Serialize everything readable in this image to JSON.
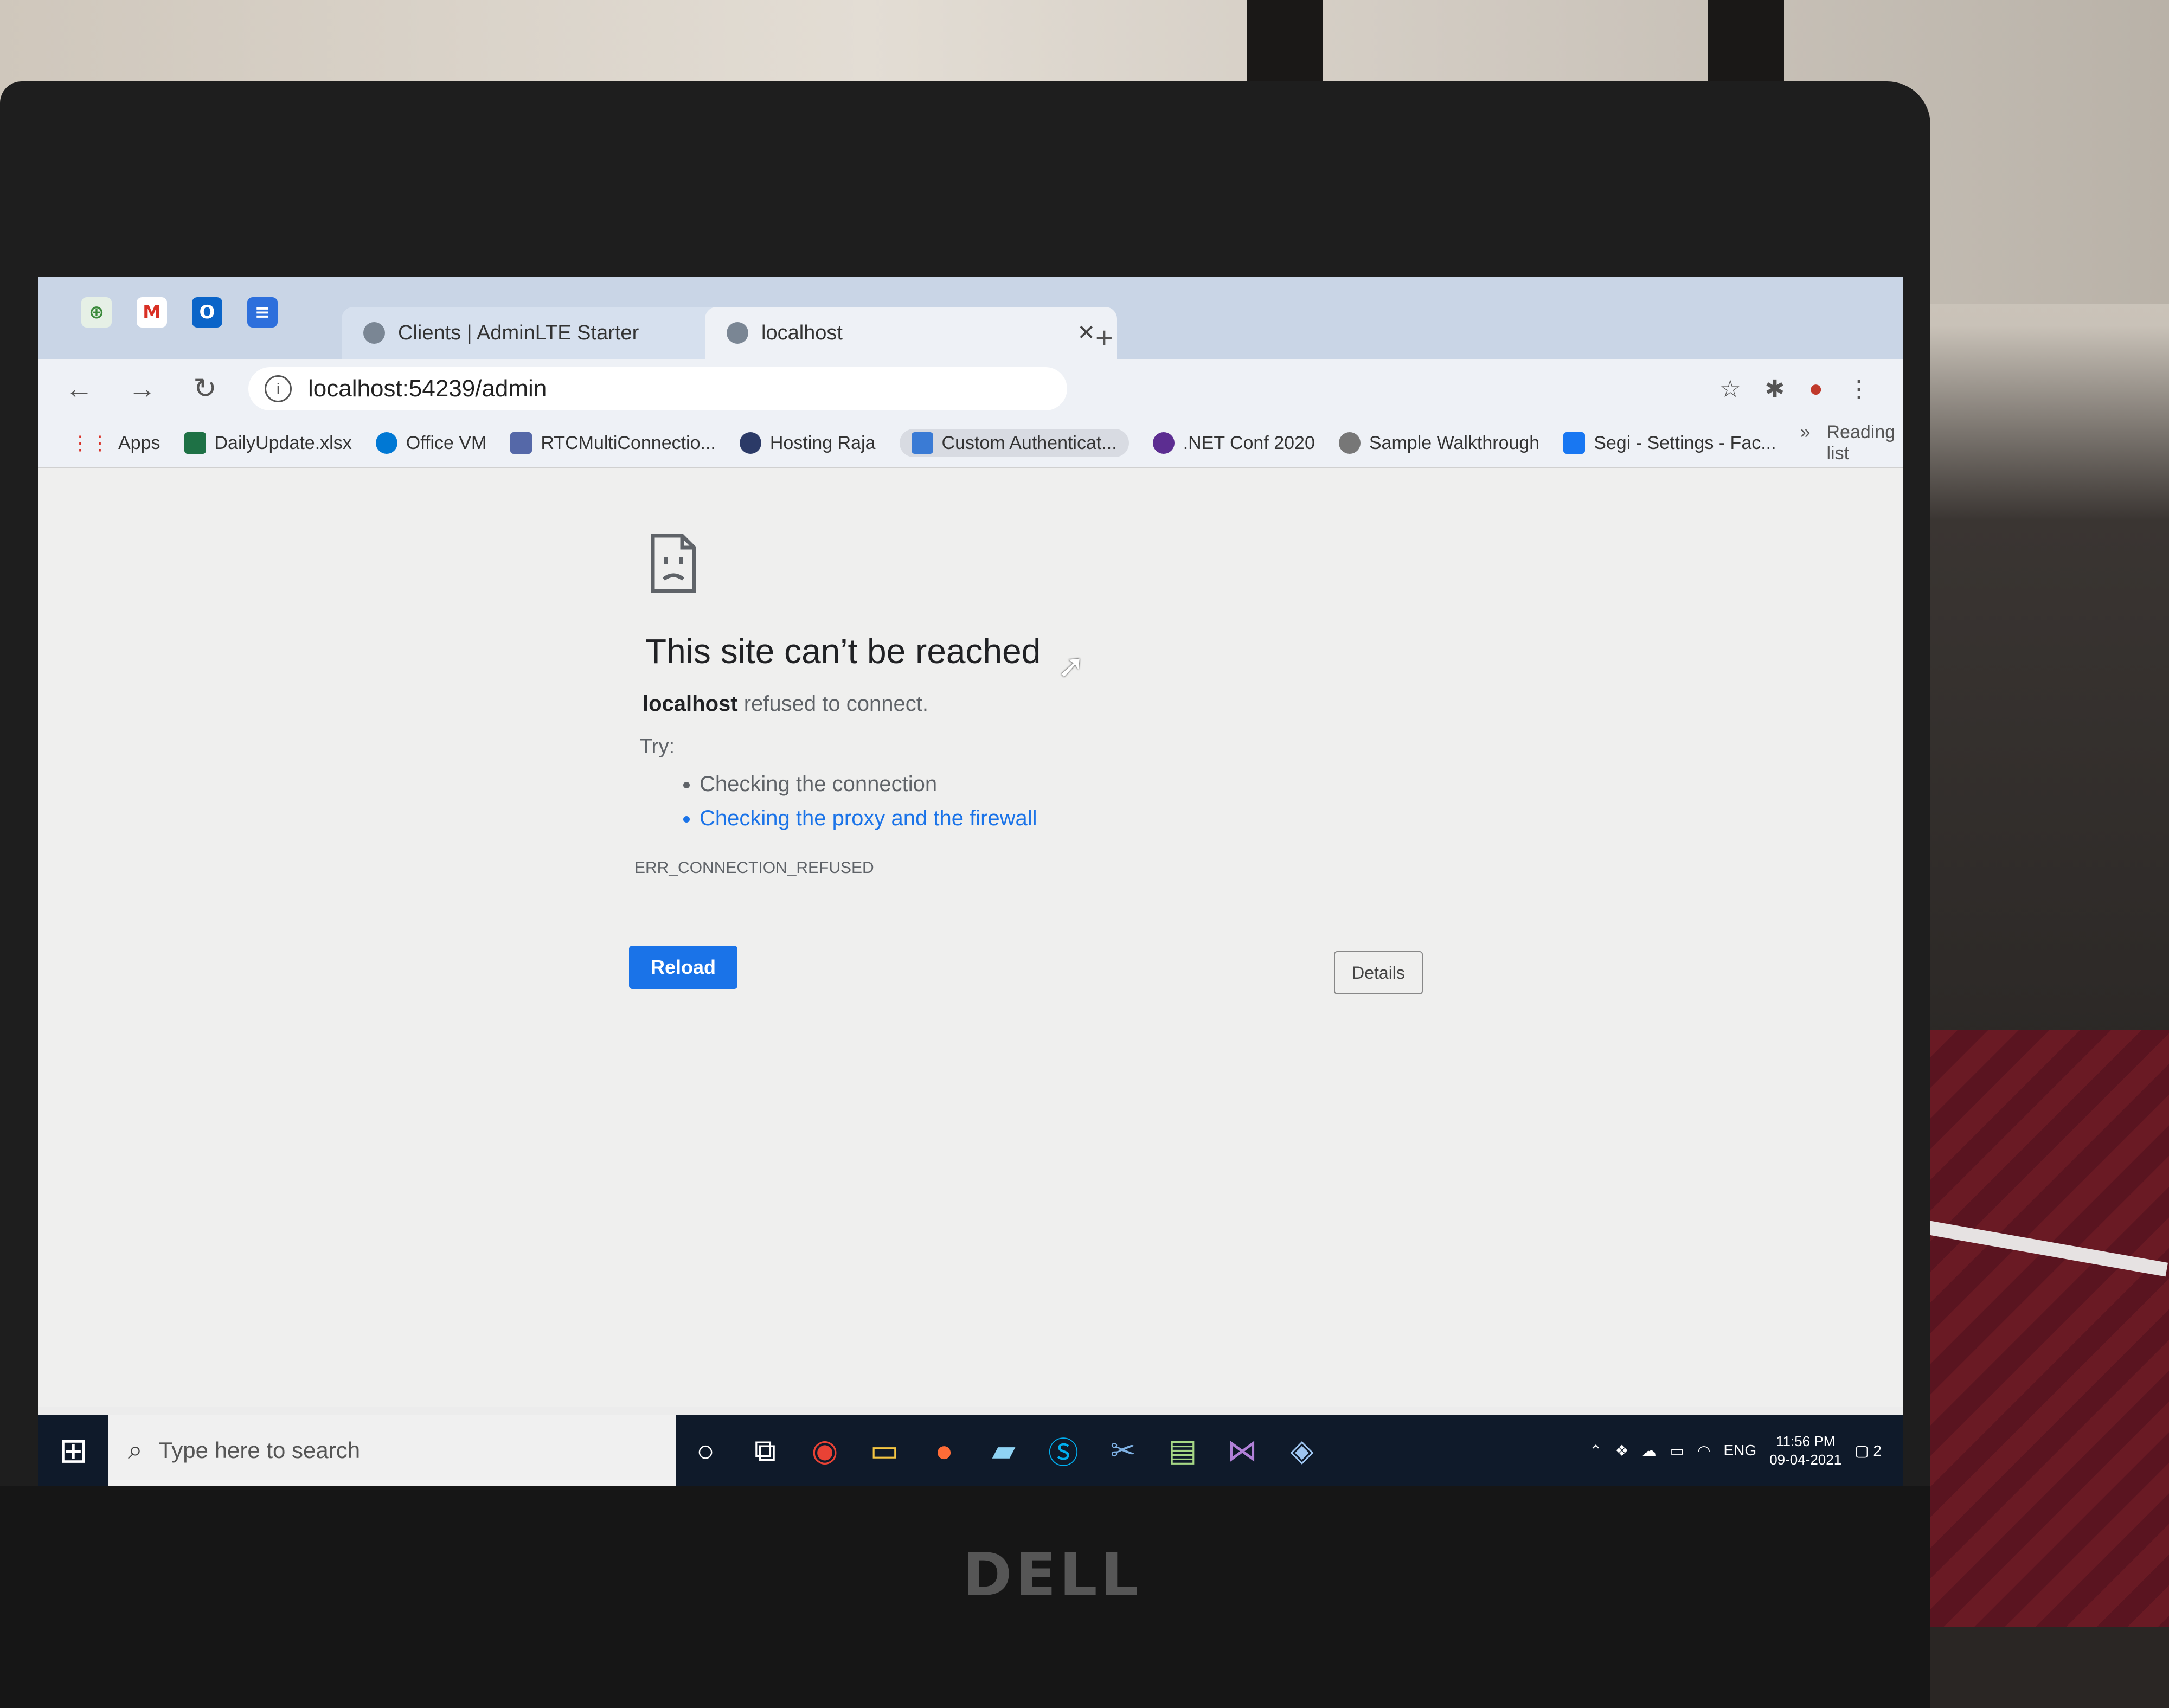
{
  "browser": {
    "tabs": [
      {
        "title": "Clients | AdminLTE Starter",
        "active": false
      },
      {
        "title": "localhost",
        "active": true
      }
    ],
    "address": "localhost:54239/admin",
    "pinned_icons": [
      "ga-icon",
      "gmail-icon",
      "outlook-icon",
      "docs-icon"
    ],
    "bookmarks": [
      {
        "label": "Apps"
      },
      {
        "label": "DailyUpdate.xlsx"
      },
      {
        "label": "Office VM"
      },
      {
        "label": "RTCMultiConnectio..."
      },
      {
        "label": "Hosting Raja"
      },
      {
        "label": "Custom Authenticat..."
      },
      {
        "label": ".NET Conf 2020"
      },
      {
        "label": "Sample Walkthrough"
      },
      {
        "label": "Segi - Settings - Fac..."
      }
    ],
    "more_label": "»",
    "reading_list": "Reading list"
  },
  "error_page": {
    "title": "This site can’t be reached",
    "host": "localhost",
    "message": "refused to connect.",
    "try_label": "Try:",
    "suggestions": [
      "Checking the connection",
      "Checking the proxy and the firewall"
    ],
    "code": "ERR_CONNECTION_REFUSED",
    "reload_label": "Reload",
    "details_label": "Details"
  },
  "taskbar": {
    "search_placeholder": "Type here to search",
    "lang": "ENG",
    "time": "11:56 PM",
    "date": "09-04-2021",
    "notifications": "2"
  },
  "laptop": {
    "brand": "DELL"
  },
  "colors": {
    "link": "#1a73e8",
    "button": "#1a73e8",
    "taskbar": "#0f1a2a"
  }
}
